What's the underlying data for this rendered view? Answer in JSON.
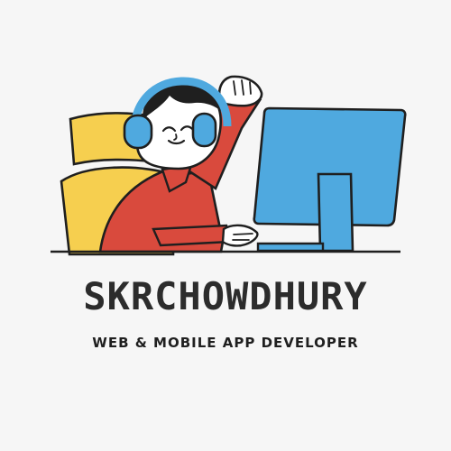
{
  "logo": {
    "title": "SKRCHOWDHURY",
    "tagline": "WEB & MOBILE APP DEVELOPER"
  },
  "colors": {
    "background": "#f6f6f6",
    "chair": "#f6cf4f",
    "shirt": "#d94a3d",
    "screen_blue": "#4fa9df",
    "outline": "#1f1f1f",
    "skin": "#ffffff",
    "headphones": "#4fa9df",
    "text": "#2c2c2c"
  },
  "icons": {
    "illustration": "developer-at-computer-illustration"
  }
}
